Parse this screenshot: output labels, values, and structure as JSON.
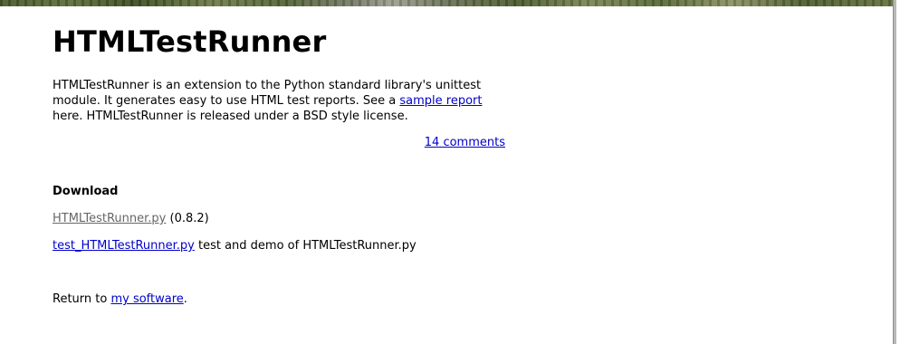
{
  "page": {
    "title": "HTMLTestRunner"
  },
  "intro": {
    "text_before_link": "HTMLTestRunner is an extension to the Python standard library's unittest module. It generates easy to use HTML test reports. See a ",
    "link_label": "sample report",
    "text_after_link": " here. HTMLTestRunner is released under a BSD style license."
  },
  "comments": {
    "label": "14 comments"
  },
  "download": {
    "heading": "Download",
    "items": [
      {
        "link_label": "HTMLTestRunner.py",
        "suffix": " (0.8.2)"
      },
      {
        "link_label": "test_HTMLTestRunner.py",
        "suffix": " test and demo of HTMLTestRunner.py"
      }
    ]
  },
  "footer": {
    "prefix": "Return to ",
    "link_label": "my software",
    "suffix": "."
  },
  "colors": {
    "link": "#0000cc",
    "visited_link": "#666666",
    "text": "#000000",
    "background": "#ffffff"
  }
}
